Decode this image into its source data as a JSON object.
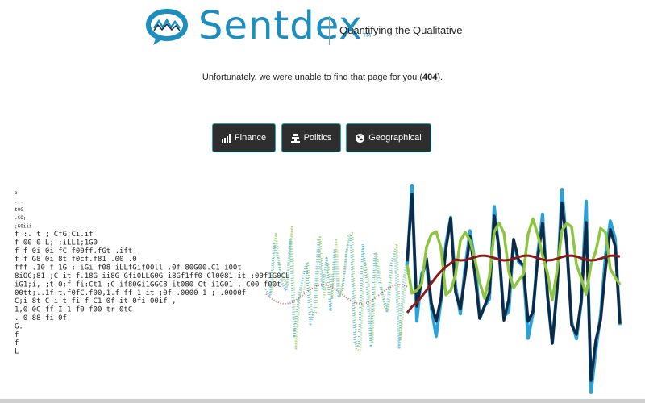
{
  "header": {
    "brand": "Sentdex",
    "trademark": "TM",
    "tagline": "Quantifying the Qualitative"
  },
  "error": {
    "prefix": "Unfortunately, we were unable to find that page for you (",
    "code": "404",
    "suffix": ")."
  },
  "nav": {
    "finance_label": "Finance",
    "politics_label": "Politics",
    "geo_label": "Geographical",
    "finance_icon": "bar-chart-icon",
    "politics_icon": "podium-icon",
    "geo_icon": "globe-icon"
  },
  "colors": {
    "brand": "#1d8fbe",
    "button_bg": "#2e2e2e",
    "button_border": "#1fa6b8",
    "line_blue": "#2aa2d8",
    "line_navy": "#0e2a47",
    "line_green": "#8cc63f",
    "line_red": "#8b1a1a"
  },
  "ascii_art": [
    "                                          o.                                         ",
    "                                          .;.                                        ",
    "                                          t0G                                        ",
    "                                         .CO;                                        ",
    "                                         ;G0iii                                      ",
    "   f                 :.    t       ;     CfG;Ci.if                                   ",
    "   f                 00    0       L;    :iLL1;1G0                                    ",
    "   f           f    0i    0i      fC     f00ff.fGt  .ift                             ",
    "   f           f    G8    0i      8t     f0cf.f81   .00   .0                          ",
    "fff .10        f    1G : iGi     f08   iLLfGif00ll  .0f   80G00.C1 i00t              ",
    "8iOC;81 ;C it f.18G   ii8G  Gfi0LLG0G i8Gf1ff0  Cl0081.it  :00f1G0CL                 ",
    "iG1;i, ;t.0:f fi:Ct1  :C   if80Gi1GGC8  it080 Ct i1G01 . C00 f00t                    ",
    "00tt;..1f:t.f0fC.f00,1.f     ff  1  it  ;0f  .0000 1 ; .0000f                         ",
    " C;i   8t C i t    fi  f     C1  0f      it 0fi  00if ,                               ",
    "  1,0   0C        ff  I      1   f0      f00 tr   0tC                                 ",
    "   . 0  88                        fi               0f                                 ",
    "        G.                                                                            ",
    "        f                                                                             ",
    "        f                                                                             ",
    "        L                                                                             "
  ]
}
